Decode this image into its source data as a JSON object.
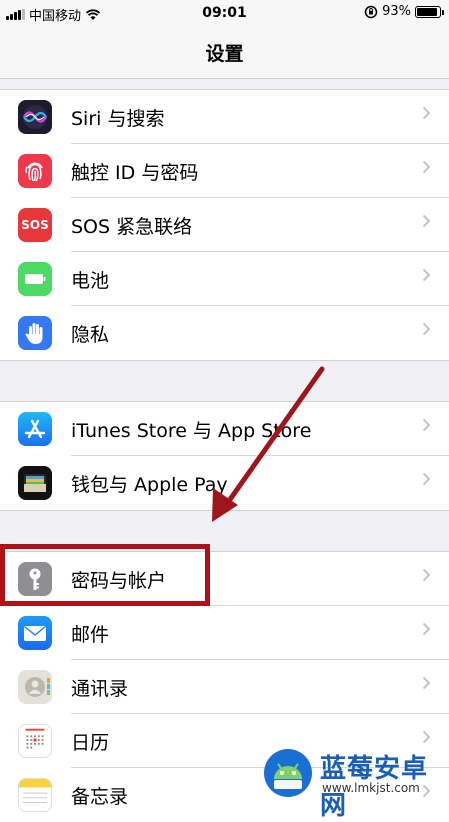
{
  "status": {
    "carrier": "中国移动",
    "time": "09:01",
    "battery": "93%",
    "battery_level": 0.93
  },
  "nav": {
    "title": "设置"
  },
  "groups": [
    {
      "items": [
        {
          "label": "Siri 与搜索",
          "icon": "siri-icon"
        },
        {
          "label": "触控 ID 与密码",
          "icon": "fingerprint-icon"
        },
        {
          "label": "SOS 紧急联络",
          "icon": "sos-icon",
          "icon_text": "SOS"
        },
        {
          "label": "电池",
          "icon": "battery-icon"
        },
        {
          "label": "隐私",
          "icon": "hand-icon"
        }
      ]
    },
    {
      "items": [
        {
          "label": "iTunes Store 与 App Store",
          "icon": "app-store-icon"
        },
        {
          "label": "钱包与 Apple Pay",
          "icon": "wallet-icon"
        }
      ]
    },
    {
      "items": [
        {
          "label": "密码与帐户",
          "icon": "key-icon"
        },
        {
          "label": "邮件",
          "icon": "mail-icon"
        },
        {
          "label": "通讯录",
          "icon": "contacts-icon"
        },
        {
          "label": "日历",
          "icon": "calendar-icon"
        },
        {
          "label": "备忘录",
          "icon": "notes-icon"
        }
      ]
    }
  ],
  "watermark": {
    "name": "蓝莓安卓网",
    "url": "www.lmkjst.com"
  },
  "colors": {
    "highlight": "#b01018",
    "arrow": "#a0141c",
    "accent": "#1a5fb4"
  }
}
